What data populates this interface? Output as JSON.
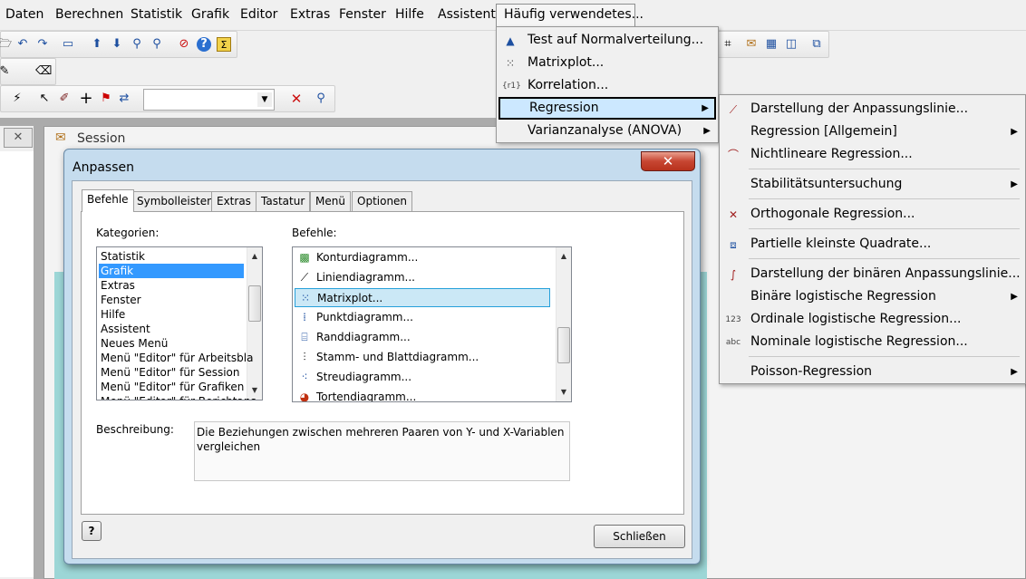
{
  "menubar": {
    "items": [
      {
        "label": "Daten",
        "u": "D"
      },
      {
        "label": "Berechnen",
        "u": "B"
      },
      {
        "label": "Statistik",
        "u": "k"
      },
      {
        "label": "Grafik",
        "u": "G"
      },
      {
        "label": "Editor",
        "u": "E"
      },
      {
        "label": "Extras",
        "u": "x"
      },
      {
        "label": "Fenster",
        "u": "F"
      },
      {
        "label": "Hilfe",
        "u": "H"
      },
      {
        "label": "Assistent",
        "u": "A"
      },
      {
        "label": "Häufig verwendetes...",
        "u": "u"
      }
    ]
  },
  "session": {
    "title": "Session"
  },
  "dialog": {
    "title": "Anpassen",
    "close_label": "✕",
    "tabs": [
      "Befehle",
      "Symbolleisten",
      "Extras",
      "Tastatur",
      "Menü",
      "Optionen"
    ],
    "categories_label": "Kategorien:",
    "categories": [
      "Statistik",
      "Grafik",
      "Extras",
      "Fenster",
      "Hilfe",
      "Assistent",
      "Neues Menü",
      "Menü \"Editor\" für Arbeitsbla",
      "Menü \"Editor\" für Session",
      "Menü \"Editor\" für Grafiken",
      "Menü \"Editor\" für Berichtans"
    ],
    "selected_category": 1,
    "commands_label": "Befehle:",
    "commands": [
      {
        "label": "Konturdiagramm...",
        "icon": "contour-plot-icon"
      },
      {
        "label": "Liniendiagramm...",
        "icon": "line-plot-icon"
      },
      {
        "label": "Matrixplot...",
        "icon": "matrix-plot-icon"
      },
      {
        "label": "Punktdiagramm...",
        "icon": "dot-plot-icon"
      },
      {
        "label": "Randdiagramm...",
        "icon": "marginal-plot-icon"
      },
      {
        "label": "Stamm- und Blattdiagramm...",
        "icon": "stem-leaf-icon"
      },
      {
        "label": "Streudiagramm...",
        "icon": "scatterplot-icon"
      },
      {
        "label": "Tortendiagramm...",
        "icon": "pie-chart-icon"
      }
    ],
    "selected_command": 2,
    "description_label": "Beschreibung:",
    "description": "Die Beziehungen zwischen mehreren Paaren von Y- und X-Variablen vergleichen",
    "help_label": "?",
    "close_button": "Schließen"
  },
  "menu_frequent": {
    "items": [
      {
        "label": "Test auf Normalverteilung...",
        "icon": "normality-test-icon"
      },
      {
        "label": "Matrixplot...",
        "icon": "matrix-plot-icon"
      },
      {
        "label": "Korrelation...",
        "icon": "correlation-icon",
        "icon_text": "{r1}"
      },
      {
        "label": "Regression",
        "submenu": true,
        "highlighted": true
      },
      {
        "label": "Varianzanalyse (ANOVA)",
        "submenu": true
      }
    ]
  },
  "menu_regression": {
    "items": [
      {
        "label": "Darstellung der Anpassungslinie...",
        "icon": "fitted-line-icon"
      },
      {
        "label": "Regression [Allgemein]",
        "submenu": true
      },
      {
        "label": "Nichtlineare Regression...",
        "icon": "nonlinear-regression-icon"
      },
      {
        "label": "Stabilitätsuntersuchung",
        "submenu": true,
        "sep_before": true
      },
      {
        "label": "Orthogonale Regression...",
        "icon": "orthogonal-regression-icon",
        "sep_before": true
      },
      {
        "label": "Partielle kleinste Quadrate...",
        "icon": "pls-icon",
        "sep_before": true
      },
      {
        "label": "Darstellung der binären Anpassungslinie...",
        "icon": "binary-fitted-line-icon",
        "sep_before": true
      },
      {
        "label": "Binäre logistische Regression",
        "submenu": true
      },
      {
        "label": "Ordinale logistische Regression...",
        "icon": "ordinal-logistic-icon",
        "icon_text": "123"
      },
      {
        "label": "Nominale logistische Regression...",
        "icon": "nominal-logistic-icon",
        "icon_text": "abc"
      },
      {
        "label": "Poisson-Regression",
        "submenu": true,
        "sep_before": true
      }
    ]
  }
}
